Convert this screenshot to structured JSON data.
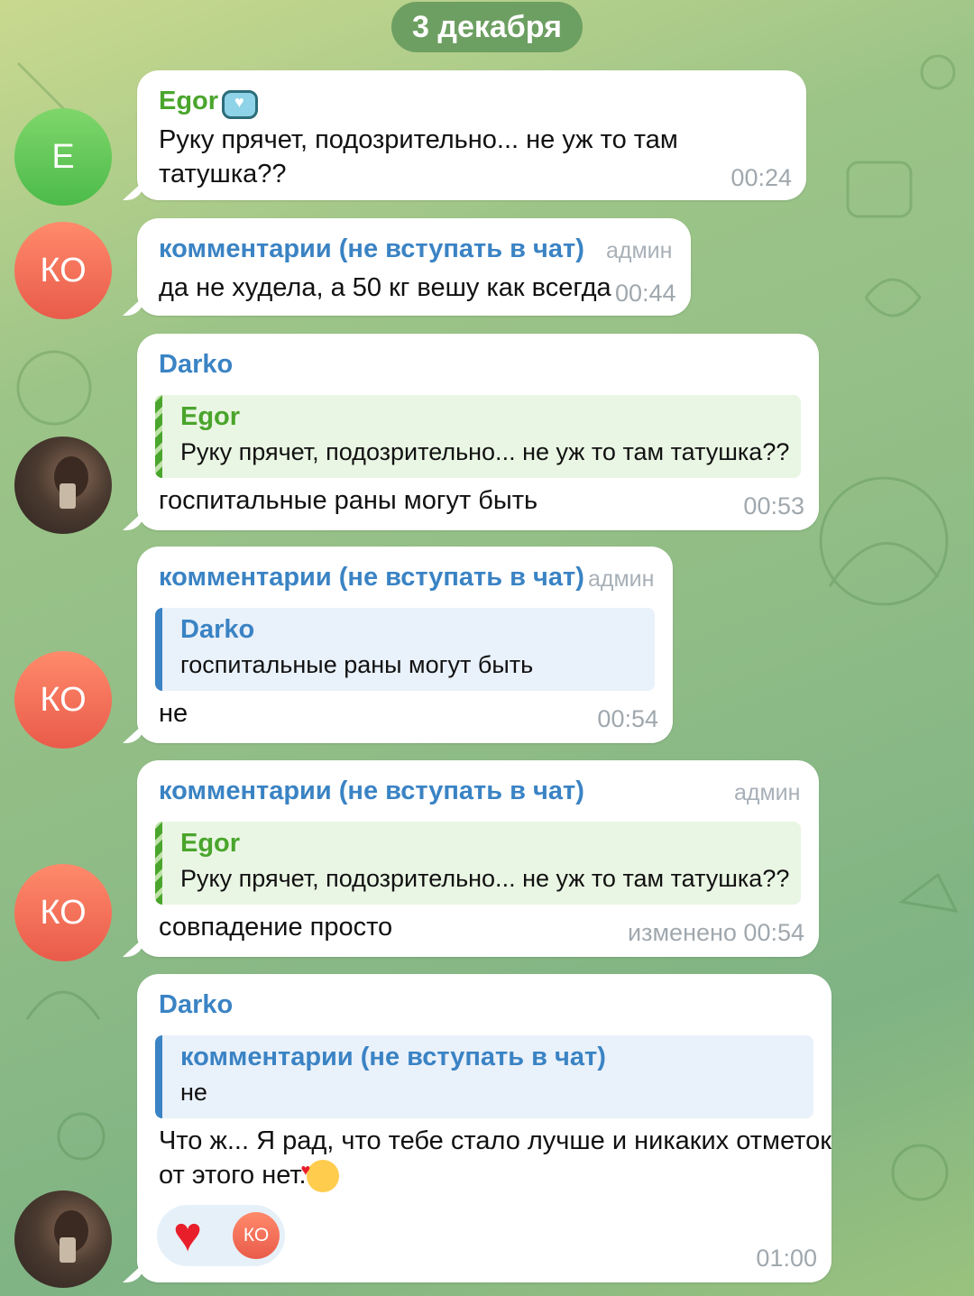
{
  "date_label": "3 декабря",
  "colors": {
    "name_green": "#4aa52c",
    "name_blue": "#3a83c4",
    "heart": "#e81f2b"
  },
  "messages": [
    {
      "avatar": "E",
      "sender": "Egor",
      "sender_badge_icon": "heart-box-emoji-icon",
      "text": "Руку прячет, подозрительно... не уж то там татушка??",
      "time": "00:24"
    },
    {
      "avatar": "КО",
      "sender": "комментарии (не вступать в чат)",
      "role": "админ",
      "text": "да не худела, а 50 кг вешу как всегда",
      "time": "00:44"
    },
    {
      "avatar": "photo",
      "sender": "Darko",
      "reply": {
        "name": "Egor",
        "text": "Руку прячет, подозрительно... не уж то там татушка??"
      },
      "text": "госпитальные раны могут быть",
      "time": "00:53"
    },
    {
      "avatar": "КО",
      "sender": "комментарии (не вступать в чат)",
      "role": "админ",
      "reply": {
        "name": "Darko",
        "text": "госпитальные раны могут быть"
      },
      "text": "не",
      "time": "00:54"
    },
    {
      "avatar": "КО",
      "sender": "комментарии (не вступать в чат)",
      "role": "админ",
      "reply": {
        "name": "Egor",
        "text": "Руку прячет, подозрительно... не уж то там татушка??"
      },
      "text": "совпадение просто",
      "time": "изменено 00:54"
    },
    {
      "avatar": "photo",
      "sender": "Darko",
      "reply": {
        "name": "комментарии (не вступать в чат)",
        "text": "не"
      },
      "text_line1": "Что ж... Я рад, что тебе стало лучше и никаких отметок",
      "text_line2": "от этого нет.",
      "text_emoji_icon": "smiling-face-with-hearts-icon",
      "reaction": {
        "emoji": "heart",
        "avatar": "КО"
      },
      "time": "01:00"
    }
  ]
}
